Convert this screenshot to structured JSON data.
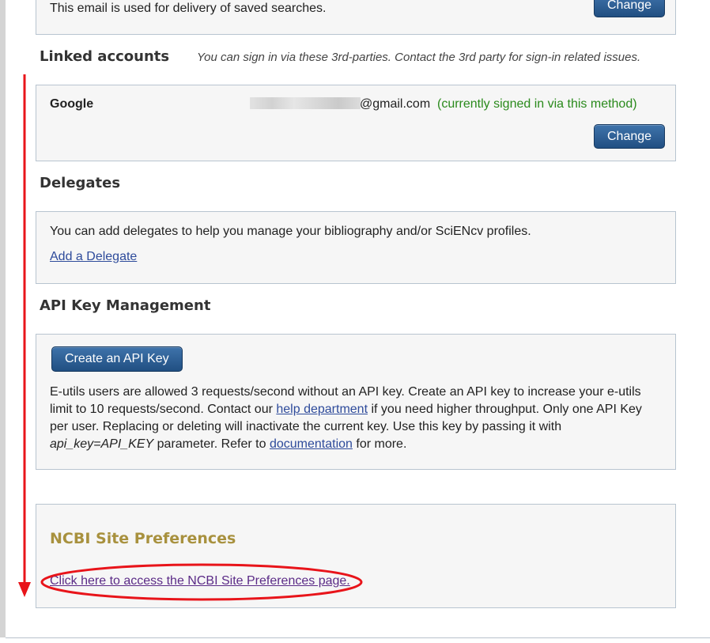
{
  "email_section": {
    "description": "This email is used for delivery of saved searches.",
    "change_label": "Change"
  },
  "linked_accounts": {
    "heading": "Linked accounts",
    "note": "You can sign in via these 3rd-parties. Contact the 3rd party for sign-in related issues.",
    "provider": "Google",
    "email_suffix": "@gmail.com",
    "status": "(currently signed in via this method)",
    "change_label": "Change"
  },
  "delegates": {
    "heading": "Delegates",
    "description": "You can add delegates to help you manage your bibliography and/or SciENcv profiles.",
    "add_link": "Add a Delegate"
  },
  "api_key": {
    "heading": "API Key Management",
    "create_label": "Create an API Key",
    "line1": "E-utils users are allowed 3 requests/second without an API key. Create an API key to increase your e-utils",
    "line2_before": "limit to 10 requests/second. Contact our",
    "help_link": "help department",
    "line2_after": "if you need higher throughput. Only one API Key",
    "line3": "per user. Replacing or deleting will inactivate the current key. Use this key by passing it with",
    "param_code": "api_key=API_KEY",
    "line4_before": "parameter. Refer to",
    "doc_link": "documentation",
    "line4_after": "for more."
  },
  "site_prefs": {
    "heading": "NCBI Site Preferences",
    "link": "Click here to access the NCBI Site Preferences page."
  },
  "colors": {
    "annotation_red": "#e8141a",
    "heading_gold": "#a8913e",
    "status_green": "#2a8a1c",
    "button_blue": "#2a5a90"
  }
}
